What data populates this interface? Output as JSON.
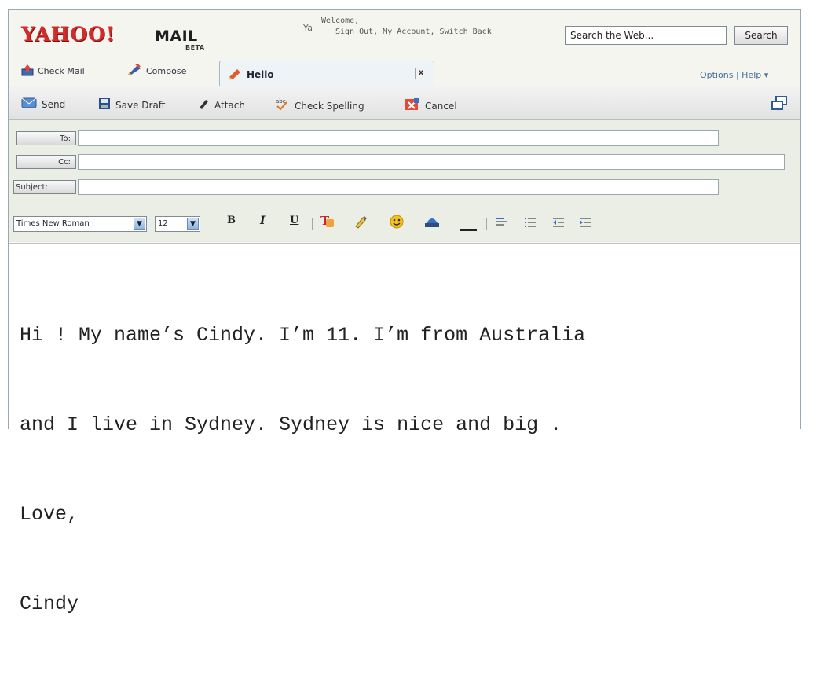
{
  "header": {
    "logo_text": "YAHOO!",
    "logo_mail": "MAIL",
    "logo_beta": "BETA",
    "ya_label": "Ya",
    "welcome": "Welcome,",
    "sign_out": "Sign Out",
    "my_account": "My Account",
    "switch_back": "Switch Back",
    "link_sep": ", ",
    "search_placeholder": "Search the Web...",
    "search_button": "Search"
  },
  "tabs": {
    "check_mail": "Check Mail",
    "compose": "Compose",
    "active_tab": "Hello",
    "close_symbol": "x",
    "options": "Options",
    "separator": " | ",
    "help": "Help ▾"
  },
  "toolbar": {
    "send": "Send",
    "save_draft": "Save Draft",
    "attach": "Attach",
    "check_spelling": "Check Spelling",
    "cancel": "Cancel"
  },
  "compose": {
    "to_label": "To:",
    "cc_label": "Cc:",
    "subject_label": "Subject:",
    "to_value": "",
    "cc_value": "",
    "subject_value": ""
  },
  "format": {
    "font_family": "Times New Roman",
    "font_size": "12",
    "bold": "B",
    "italic": "I",
    "underline": "U"
  },
  "message": {
    "line1": "Hi ! My name’s Cindy. I’m 11. I’m from Australia",
    "line2": "and I live in Sydney. Sydney is nice and big .",
    "line3": "Love,",
    "line4": "Cindy"
  },
  "colors": {
    "brand_red": "#d52a2a",
    "link_blue": "#4a6d9c",
    "accent_blue": "#6a8bb3"
  }
}
